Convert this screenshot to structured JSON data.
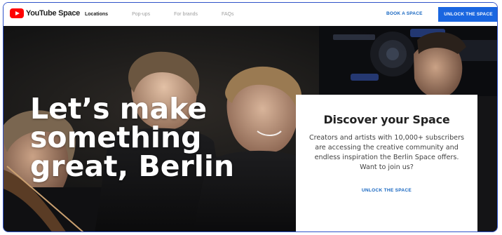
{
  "brand": {
    "name": "YouTube Space",
    "logo_color": "#ff0000"
  },
  "nav": {
    "items": [
      {
        "label": "Locations",
        "active": true
      },
      {
        "label": "Pop-ups",
        "active": false
      },
      {
        "label": "For brands",
        "active": false
      },
      {
        "label": "FAQs",
        "active": false
      }
    ],
    "book_label": "BOOK A SPACE",
    "unlock_label": "UNLOCK THE SPACE"
  },
  "hero": {
    "title_lines": [
      "Let’s make",
      "something",
      "great, Berlin"
    ]
  },
  "card": {
    "title": "Discover your Space",
    "body": "Creators and artists with 10,000+ subscribers are accessing the creative community and endless inspiration the Berlin Space offers. Want to join us?",
    "cta": "UNLOCK THE SPACE"
  },
  "colors": {
    "accent": "#1a66e0",
    "link": "#1565c0",
    "frame_border": "#2f52c9"
  },
  "icons": [
    "youtube-play-icon"
  ]
}
